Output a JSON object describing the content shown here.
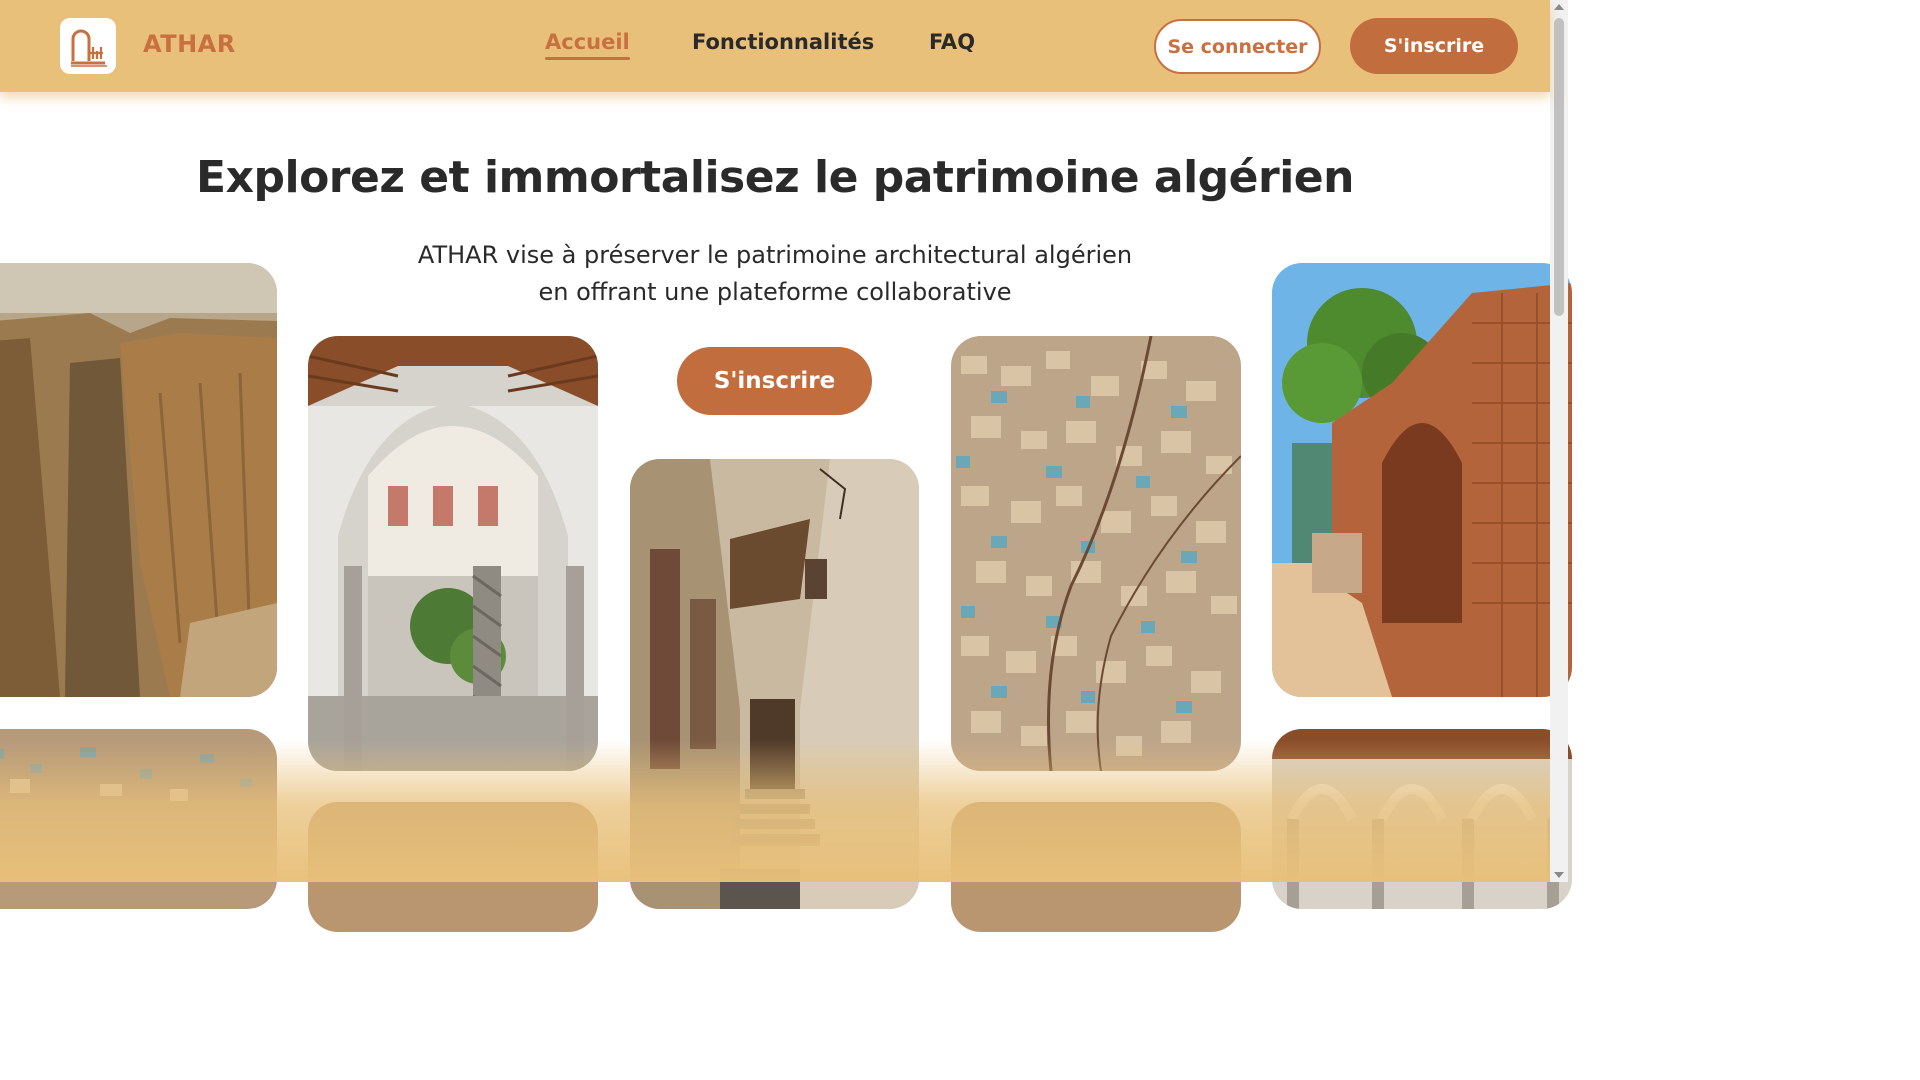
{
  "brand": {
    "name": "ATHAR",
    "logo_icon": "athar-logo-icon"
  },
  "nav": {
    "items": [
      {
        "label": "Accueil",
        "active": true
      },
      {
        "label": "Fonctionnalités",
        "active": false
      },
      {
        "label": "FAQ",
        "active": false
      }
    ]
  },
  "auth": {
    "login_label": "Se connecter",
    "signup_label": "S'inscrire"
  },
  "hero": {
    "title": "Explorez et immortalisez le patrimoine algérien",
    "subtitle_line1": "ATHAR vise à préserver le patrimoine architectural algérien",
    "subtitle_line2": "en offrant une plateforme collaborative",
    "cta_label": "S'inscrire"
  },
  "gallery": [
    {
      "name": "canyon-photo"
    },
    {
      "name": "arched-courtyard-photo"
    },
    {
      "name": "casbah-alley-photo"
    },
    {
      "name": "mzab-city-aerial-photo"
    },
    {
      "name": "roman-ruins-photo"
    }
  ],
  "colors": {
    "accent": "#c26d3d",
    "header_bg": "#e8c07a",
    "text": "#2a2a2a"
  }
}
